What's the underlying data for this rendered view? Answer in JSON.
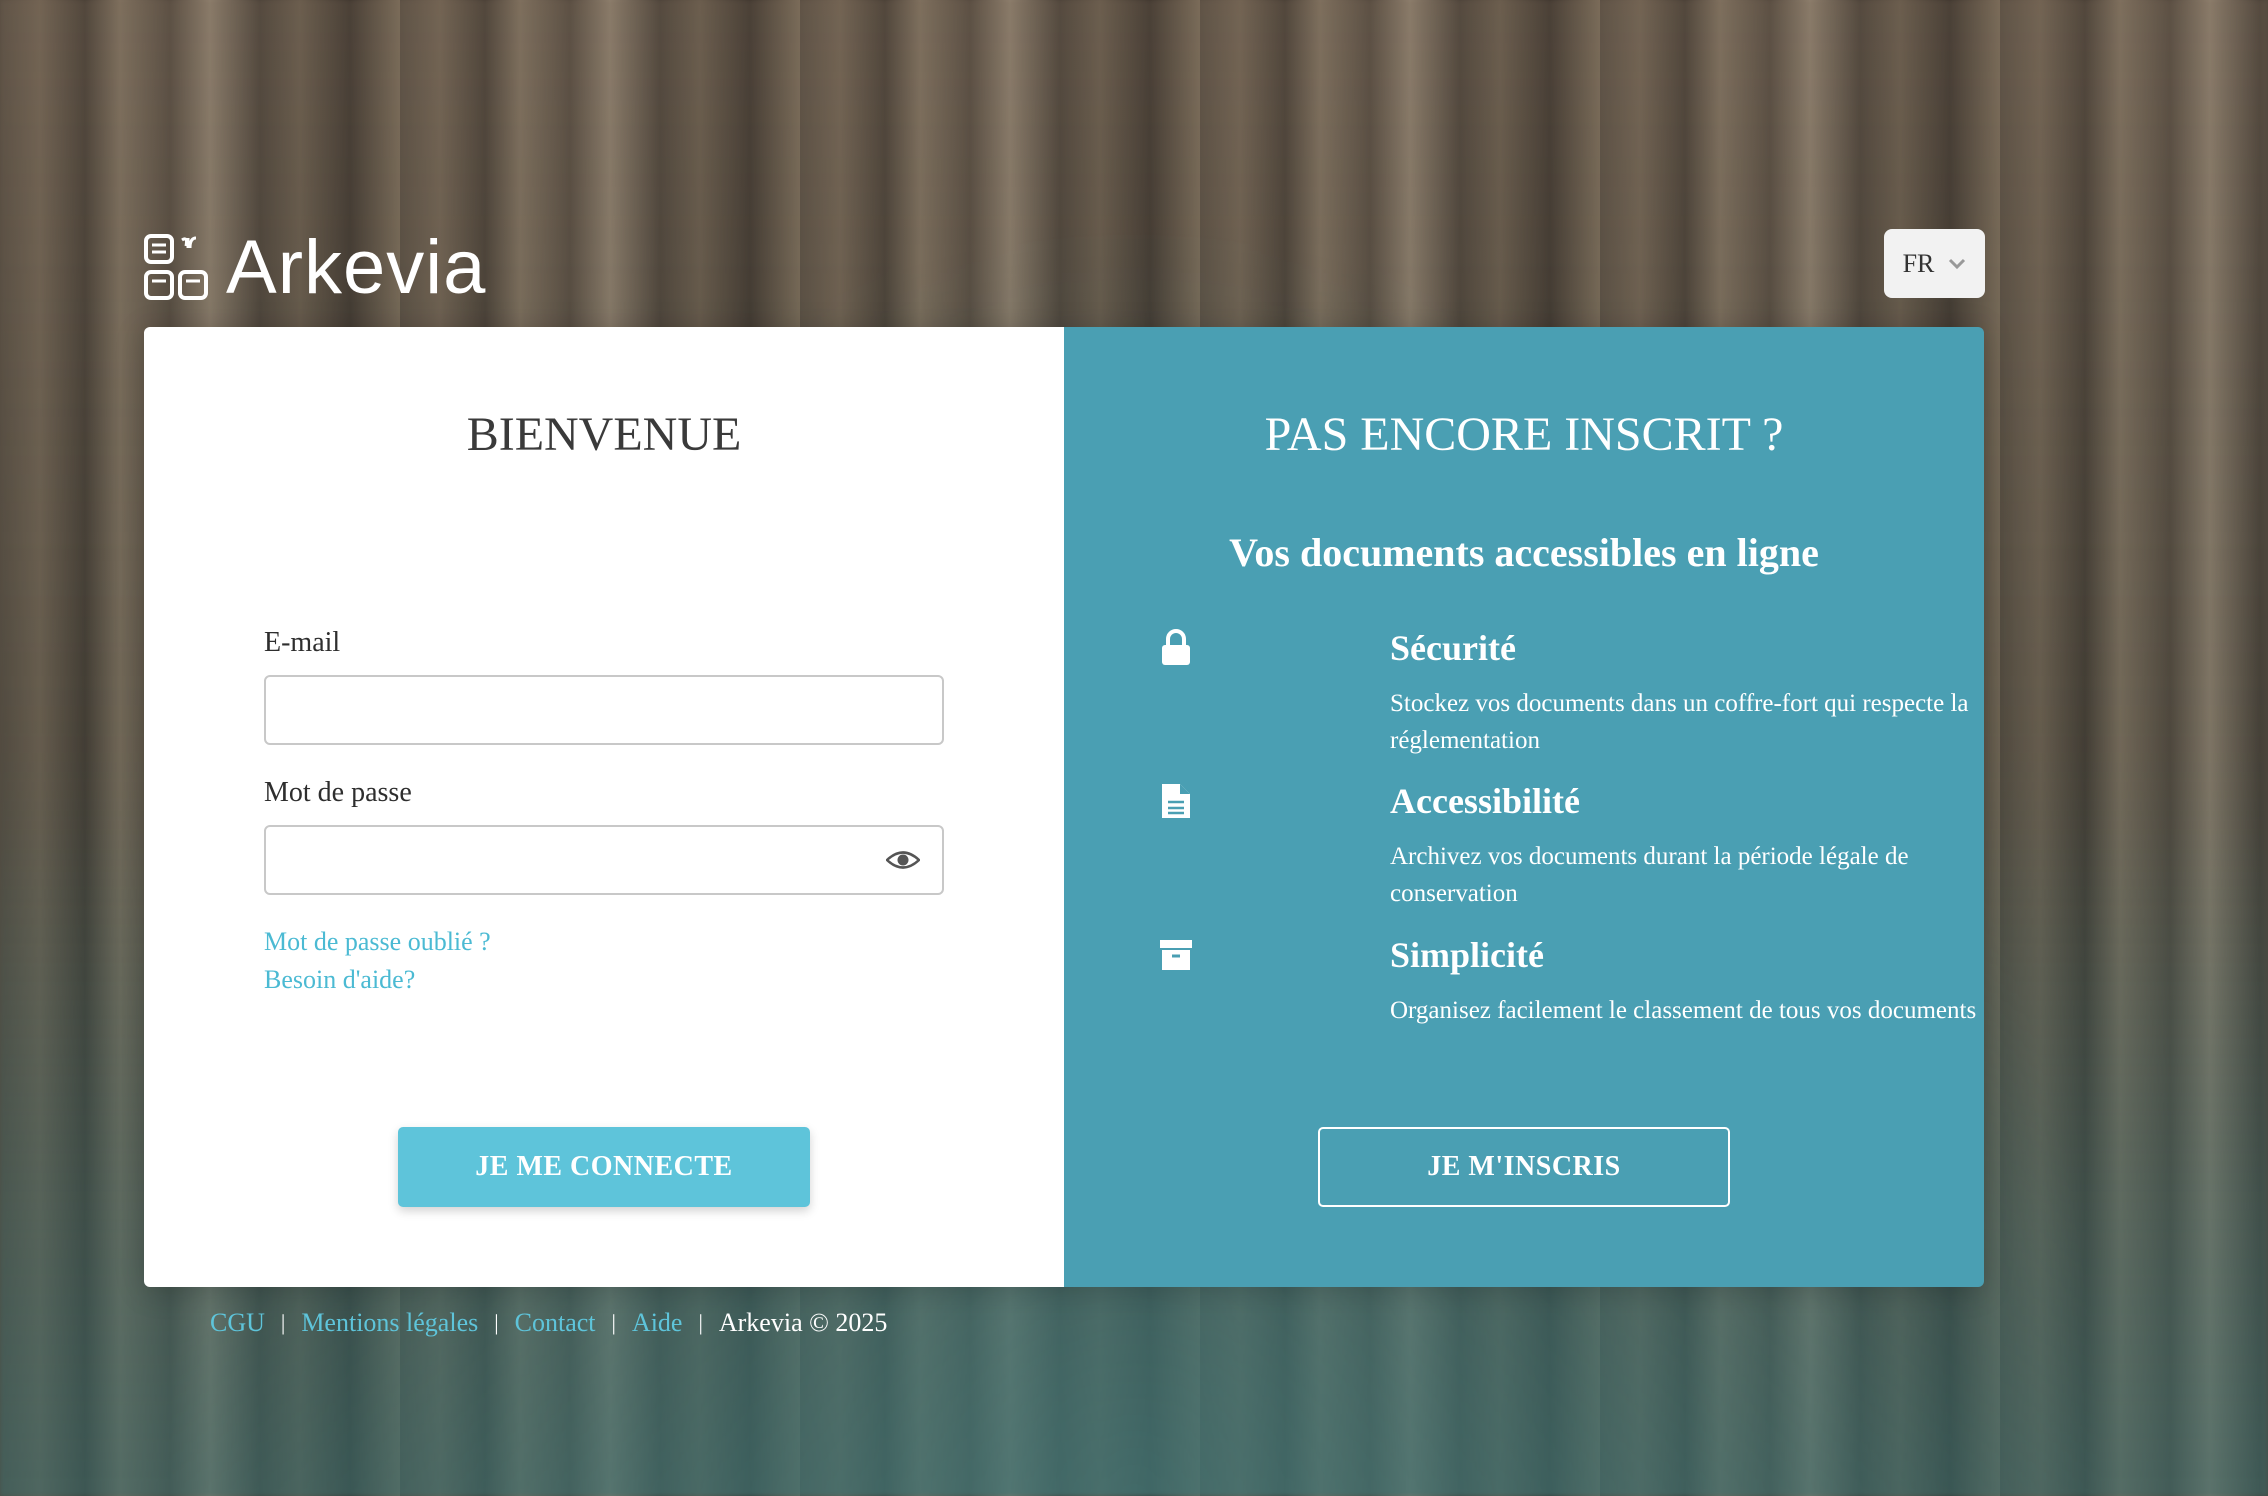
{
  "header": {
    "brand": "Arkevia",
    "language": "FR"
  },
  "login": {
    "title": "BIENVENUE",
    "email_label": "E-mail",
    "email_value": "",
    "password_label": "Mot de passe",
    "password_value": "",
    "forgot_link": "Mot de passe oublié ?",
    "help_link": "Besoin d'aide?",
    "submit_label": "JE ME CONNECTE"
  },
  "signup": {
    "title": "PAS ENCORE INSCRIT ?",
    "subtitle": "Vos documents accessibles en ligne",
    "features": [
      {
        "icon": "lock-icon",
        "title": "Sécurité",
        "desc": "Stockez vos documents dans un coffre-fort qui respecte la réglementation"
      },
      {
        "icon": "document-icon",
        "title": "Accessibilité",
        "desc": "Archivez vos documents durant la période légale de conservation"
      },
      {
        "icon": "archive-box-icon",
        "title": "Simplicité",
        "desc": "Organisez facilement le classement de tous vos documents"
      }
    ],
    "submit_label": "JE M'INSCRIS"
  },
  "footer": {
    "links": [
      "CGU",
      "Mentions légales",
      "Contact",
      "Aide"
    ],
    "copyright": "Arkevia © 2025"
  },
  "colors": {
    "accent": "#5ec4da",
    "panel_right": "#4a9fb3",
    "link": "#4bbad3"
  }
}
